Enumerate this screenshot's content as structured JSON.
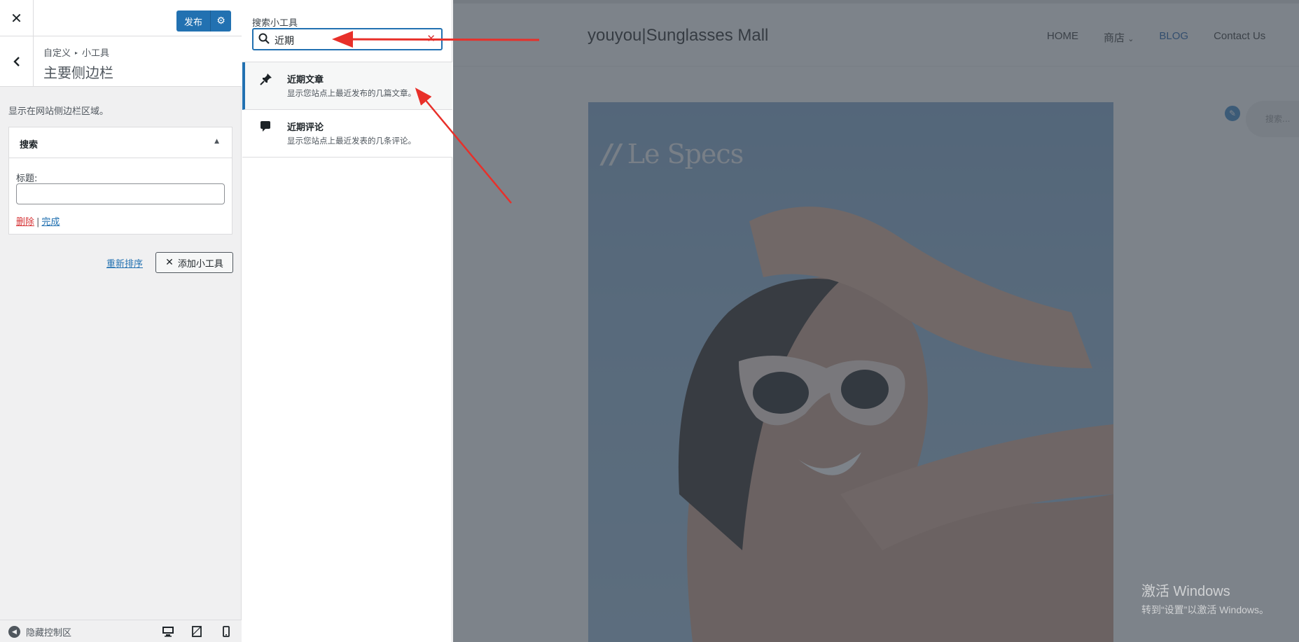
{
  "customizer": {
    "publish_label": "发布",
    "breadcrumb_root": "自定义",
    "breadcrumb_section": "小工具",
    "section_title": "主要侧边栏",
    "section_description": "显示在网站侧边栏区域。",
    "widget": {
      "title": "搜索",
      "field_label": "标题:",
      "field_value": "",
      "delete_label": "删除",
      "separator": "|",
      "done_label": "完成"
    },
    "reorder_label": "重新排序",
    "add_widget_label": "添加小工具",
    "collapse_label": "隐藏控制区"
  },
  "available_widgets": {
    "search_label": "搜索小工具",
    "search_value": "近期",
    "items": [
      {
        "name": "近期文章",
        "description": "显示您站点上最近发布的几篇文章。",
        "icon": "pin-icon",
        "selected": true
      },
      {
        "name": "近期评论",
        "description": "显示您站点上最近发表的几条评论。",
        "icon": "comment-icon",
        "selected": false
      }
    ]
  },
  "preview": {
    "site_title": "youyou|Sunglasses Mall",
    "nav": [
      {
        "label": "HOME",
        "active": false
      },
      {
        "label": "商店",
        "active": false,
        "has_dropdown": true
      },
      {
        "label": "BLOG",
        "active": true
      },
      {
        "label": "Contact Us",
        "active": false
      }
    ],
    "hero_logo": "Le Specs",
    "hero_logo_mark": "//",
    "search_placeholder": "搜索..."
  },
  "watermark": {
    "line1": "激活 Windows",
    "line2": "转到“设置”以激活 Windows。"
  },
  "colors": {
    "accent": "#2271b1",
    "annotation_arrow": "#e8302a",
    "delete": "#d63638"
  }
}
